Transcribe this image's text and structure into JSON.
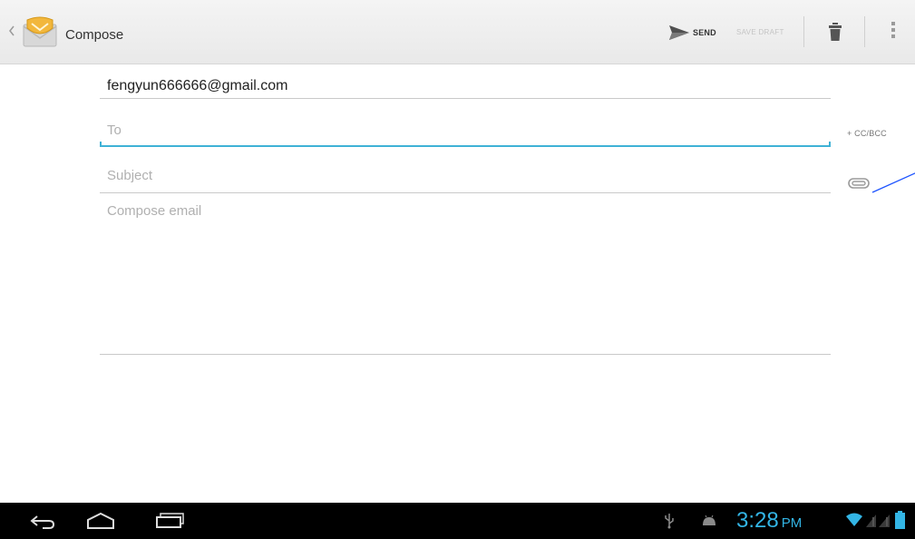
{
  "action_bar": {
    "title": "Compose",
    "send_label": "SEND",
    "save_draft_label": "SAVE DRAFT",
    "icons": [
      "up-caret-icon",
      "email-app-icon",
      "send-icon",
      "trash-icon",
      "overflow-menu-icon"
    ]
  },
  "compose": {
    "from": "fengyun666666@gmail.com",
    "to": {
      "placeholder": "To",
      "value": ""
    },
    "cc_bcc_label": "+ CC/BCC",
    "subject": {
      "placeholder": "Subject",
      "value": ""
    },
    "body": {
      "placeholder": "Compose email",
      "value": ""
    },
    "icons": [
      "attach-icon"
    ]
  },
  "system_bar": {
    "time": "3:28",
    "ampm": "PM",
    "icons": [
      "back-icon",
      "home-icon",
      "recent-apps-icon",
      "usb-icon",
      "android-debug-icon",
      "wifi-icon",
      "signal-icon",
      "battery-icon"
    ]
  },
  "colors": {
    "accent": "#33b5e5",
    "focus_underline": "#3fb2d6",
    "annotation": "#1f55ff",
    "system_bar": "#000000"
  }
}
